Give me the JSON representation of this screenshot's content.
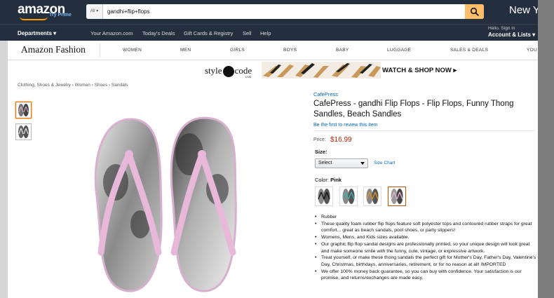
{
  "header": {
    "logo": "amazon",
    "try_prime": "Try Prime",
    "search_category": "All",
    "search_value": "gandhi+flip+flops",
    "promo_right": "New Y"
  },
  "subnav": {
    "departments": "Departments",
    "links": [
      "Your Amazon.com",
      "Today's Deals",
      "Gift Cards & Registry",
      "Sell",
      "Help"
    ],
    "hello": "Hello. Sign in",
    "account": "Account & Lists"
  },
  "fashion": {
    "logo": "Amazon Fashion",
    "nav": [
      "WOMEN",
      "MEN",
      "GIRLS",
      "BOYS",
      "BABY",
      "LUGGAGE",
      "SALES & DEALS",
      "YOU"
    ]
  },
  "promo": {
    "brand": "style code",
    "brand_left": "style",
    "brand_right": "code",
    "live": "LIVE",
    "cta": "WATCH & SHOP NOW"
  },
  "breadcrumb": "Clothing, Shoes & Jewelry › Women › Shoes › Sandals",
  "product": {
    "brand": "CafePress",
    "title": "CafePress - gandhi Flip Flops - Flip Flops, Funny Thong Sandles, Beach Sandles",
    "review_link": "Be the first to review this item",
    "price_label": "Price:",
    "price": "$16.99",
    "size_label": "Size:",
    "size_value": "Select",
    "size_chart": "Size Chart",
    "color_label": "Color:",
    "color_value": "Pink",
    "bullets": [
      "Rubber",
      "These quality foam rubber flip flops feature soft polyester tops and contoured rubber straps for great comfort... great as beach sandals, pool shoes, or party slippers!",
      "Womens, Mens, and Kids sizes available.",
      "Our graphic flip flop sandal designs are professionally printed, so your unique design will look great and make someone smile with the funny, cute, vintage, or expressive artwork.",
      "Treat yourself, or make these thong sandals the perfect gift for Mother's Day, Father's Day, Valentine's Day, Christmas, birthdays, anniversaries, retirement, or for no reason at all! IMPORTED",
      "We offer 100% money back guarantee, so you can buy with confidence. Your satisfaction is our promise, and returns/exchanges are made easy."
    ]
  },
  "colors": {
    "nav_bg": "#232f3e",
    "search_button": "#febd69",
    "link": "#0066c0",
    "price": "#b12704",
    "strap": "#e8b8d8",
    "selected": "#e77600"
  }
}
